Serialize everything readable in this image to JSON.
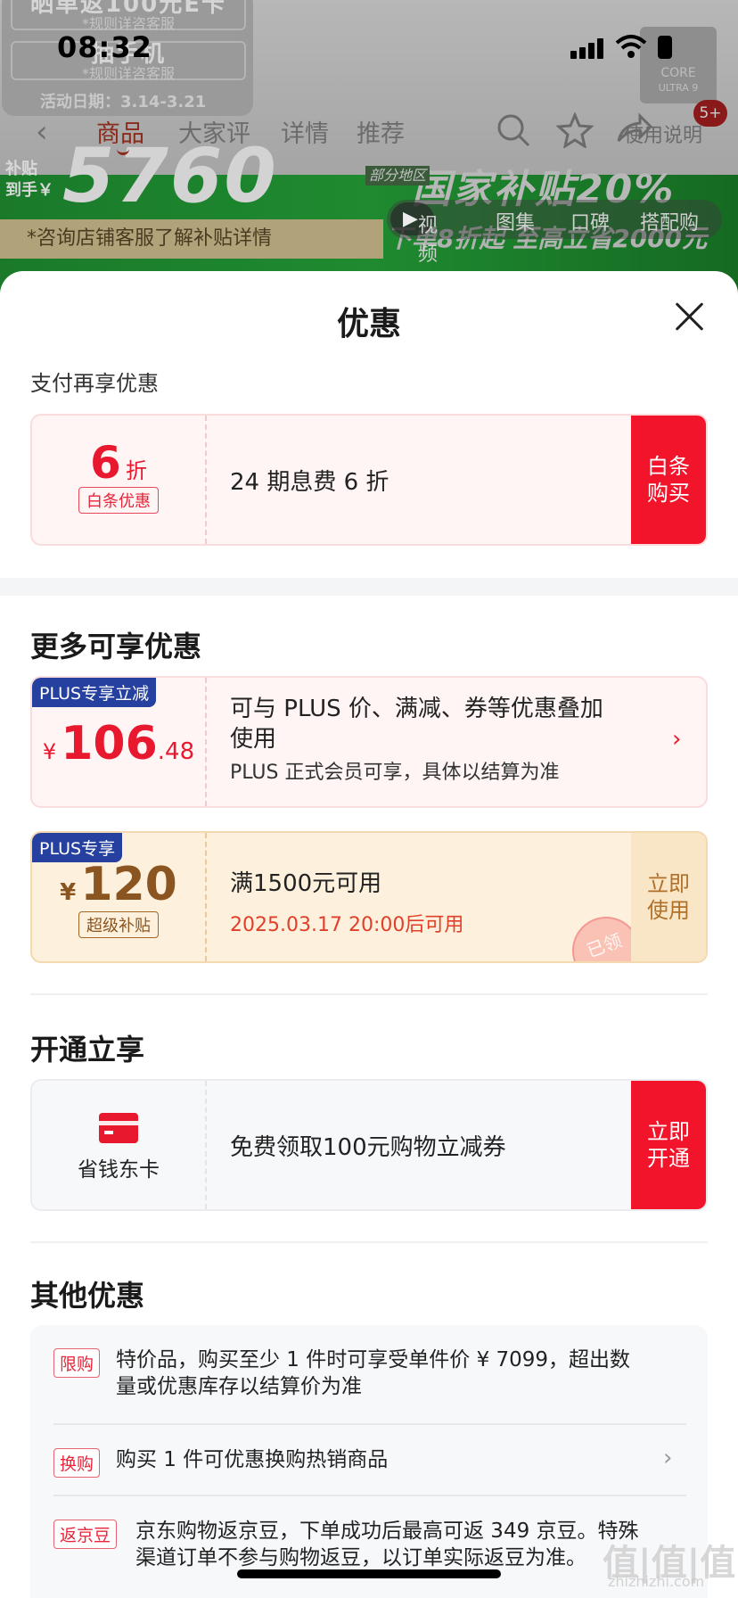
{
  "status_bar": {
    "time": "08:32"
  },
  "background": {
    "card_line1": "晒单返100元E卡",
    "card_line1_sub": "*规则详咨客服",
    "card_line2": "抽手机",
    "card_line2_sub": "*规则详咨客服",
    "activity_date": "活动日期：3.14-3.21",
    "chip_text": "CORE",
    "chip_sub": "ULTRA 9",
    "cart_badge": "5+",
    "nav_tabs": [
      "商品",
      "大家评",
      "详情",
      "推荐"
    ],
    "help_label": "使用说明",
    "subsidy_label_1": "补贴",
    "subsidy_label_2": "到手￥",
    "price": "5760",
    "gov_tag": "部分地区",
    "gov_subsidy": "国家补贴20%",
    "consult_text": "*咨询店铺客服了解补贴详情",
    "media_tabs": [
      "视频",
      "图集",
      "口碑",
      "搭配购"
    ],
    "promo_bottom": "下单8折起 至高立省2000元"
  },
  "sheet": {
    "title": "优惠",
    "pay_section": {
      "subtitle": "支付再享优惠",
      "coupon": {
        "discount_number": "6",
        "discount_unit": "折",
        "tag": "白条优惠",
        "description": "24 期息费 6 折",
        "action": "白条购买"
      }
    },
    "more_section": {
      "title": "更多可享优惠",
      "plus_coupon": {
        "tag": "PLUS专享立减",
        "currency": "¥",
        "amount_int": "106",
        "amount_dec": ".48",
        "description_line1": "可与 PLUS 价、满减、券等优惠叠加",
        "description_line2": "使用",
        "note": "PLUS 正式会员可享，具体以结算为准"
      },
      "subsidy_coupon": {
        "tag": "PLUS专享",
        "currency": "¥",
        "amount": "120",
        "badge": "超级补贴",
        "condition": "满1500元可用",
        "valid_time": "2025.03.17 20:00后可用",
        "action": "立即使用",
        "stamp": "已领"
      }
    },
    "open_section": {
      "title": "开通立享",
      "card": {
        "name": "省钱东卡",
        "description": "免费领取100元购物立减券",
        "action": "立即开通"
      }
    },
    "other_section": {
      "title": "其他优惠",
      "items": [
        {
          "tag": "限购",
          "text_line1": "特价品，购买至少 1 件时可享受单件价 ¥ 7099，超出数",
          "text_line2": "量或优惠库存以结算价为准"
        },
        {
          "tag": "换购",
          "text_line1": "购买 1 件可优惠换购热销商品"
        },
        {
          "tag": "返京豆",
          "text_line1": "京东购物返京豆，下单成功后最高可返 349 京豆。特殊",
          "text_line2": "渠道订单不参与购物返豆，以订单实际返豆为准。"
        }
      ]
    }
  },
  "watermark": {
    "text": "值|值|值",
    "url": "zhizhizhi.com"
  },
  "colors": {
    "accent_red": "#f2142b",
    "plus_blue": "#2640a0",
    "gold": "#fdf0dc"
  }
}
